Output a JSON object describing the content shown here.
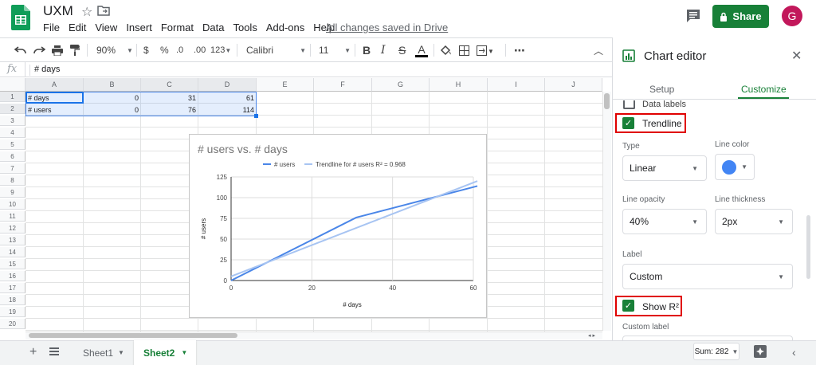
{
  "app": {
    "title": "UXM",
    "menu": [
      "File",
      "Edit",
      "View",
      "Insert",
      "Format",
      "Data",
      "Tools",
      "Add-ons",
      "Help"
    ],
    "save_status": "All changes saved in Drive",
    "share_label": "Share",
    "avatar_initial": "G",
    "brand_color": "#188038"
  },
  "toolbar": {
    "zoom": "90%",
    "currency": "$",
    "percent": "%",
    "decimal_decrease": ".0",
    "decimal_increase": ".00",
    "more_formats": "123",
    "font": "Calibri",
    "font_size": "11",
    "bold": "B",
    "italic": "I",
    "strike": "S",
    "text_color": "A"
  },
  "formula_bar": {
    "fx": "fx",
    "value": "# days"
  },
  "grid": {
    "columns": [
      "A",
      "B",
      "C",
      "D",
      "E",
      "F",
      "G",
      "H",
      "I",
      "J"
    ],
    "rows": [
      "1",
      "2",
      "3",
      "4",
      "5",
      "6",
      "7",
      "8",
      "9",
      "10",
      "11",
      "12",
      "13",
      "14",
      "15",
      "16",
      "17",
      "18",
      "19",
      "20"
    ],
    "cells": [
      [
        "# days",
        "0",
        "31",
        "61"
      ],
      [
        "# users",
        "0",
        "76",
        "114"
      ]
    ]
  },
  "chart_data": {
    "type": "line",
    "title": "# users vs. # days",
    "xlabel": "# days",
    "ylabel": "# users",
    "x": [
      0,
      31,
      61
    ],
    "series": [
      {
        "name": "# users",
        "values": [
          0,
          76,
          114
        ],
        "color": "#4a86e8"
      },
      {
        "name": "Trendline for # users R² = 0.968",
        "x": [
          0,
          61
        ],
        "values": [
          5,
          120
        ],
        "color": "#a7c4f2"
      }
    ],
    "xlim": [
      0,
      60
    ],
    "ylim": [
      0,
      125
    ],
    "xticks": [
      0,
      20,
      40,
      60
    ],
    "yticks": [
      0,
      25,
      50,
      75,
      100,
      125
    ],
    "grid": true,
    "legend": "top"
  },
  "sheets": {
    "tabs": [
      {
        "label": "Sheet1",
        "active": false
      },
      {
        "label": "Sheet2",
        "active": true
      }
    ],
    "sum": "Sum: 282"
  },
  "editor": {
    "title": "Chart editor",
    "tabs": [
      "Setup",
      "Customize"
    ],
    "active_tab": "Customize",
    "data_labels": "Data labels",
    "trendline": "Trendline",
    "type_label": "Type",
    "type_value": "Linear",
    "line_color_label": "Line color",
    "line_color": "#4285f4",
    "opacity_label": "Line opacity",
    "opacity_value": "40%",
    "thickness_label": "Line thickness",
    "thickness_value": "2px",
    "label_label": "Label",
    "label_value": "Custom",
    "show_r2": "Show R²",
    "custom_label": "Custom label"
  }
}
